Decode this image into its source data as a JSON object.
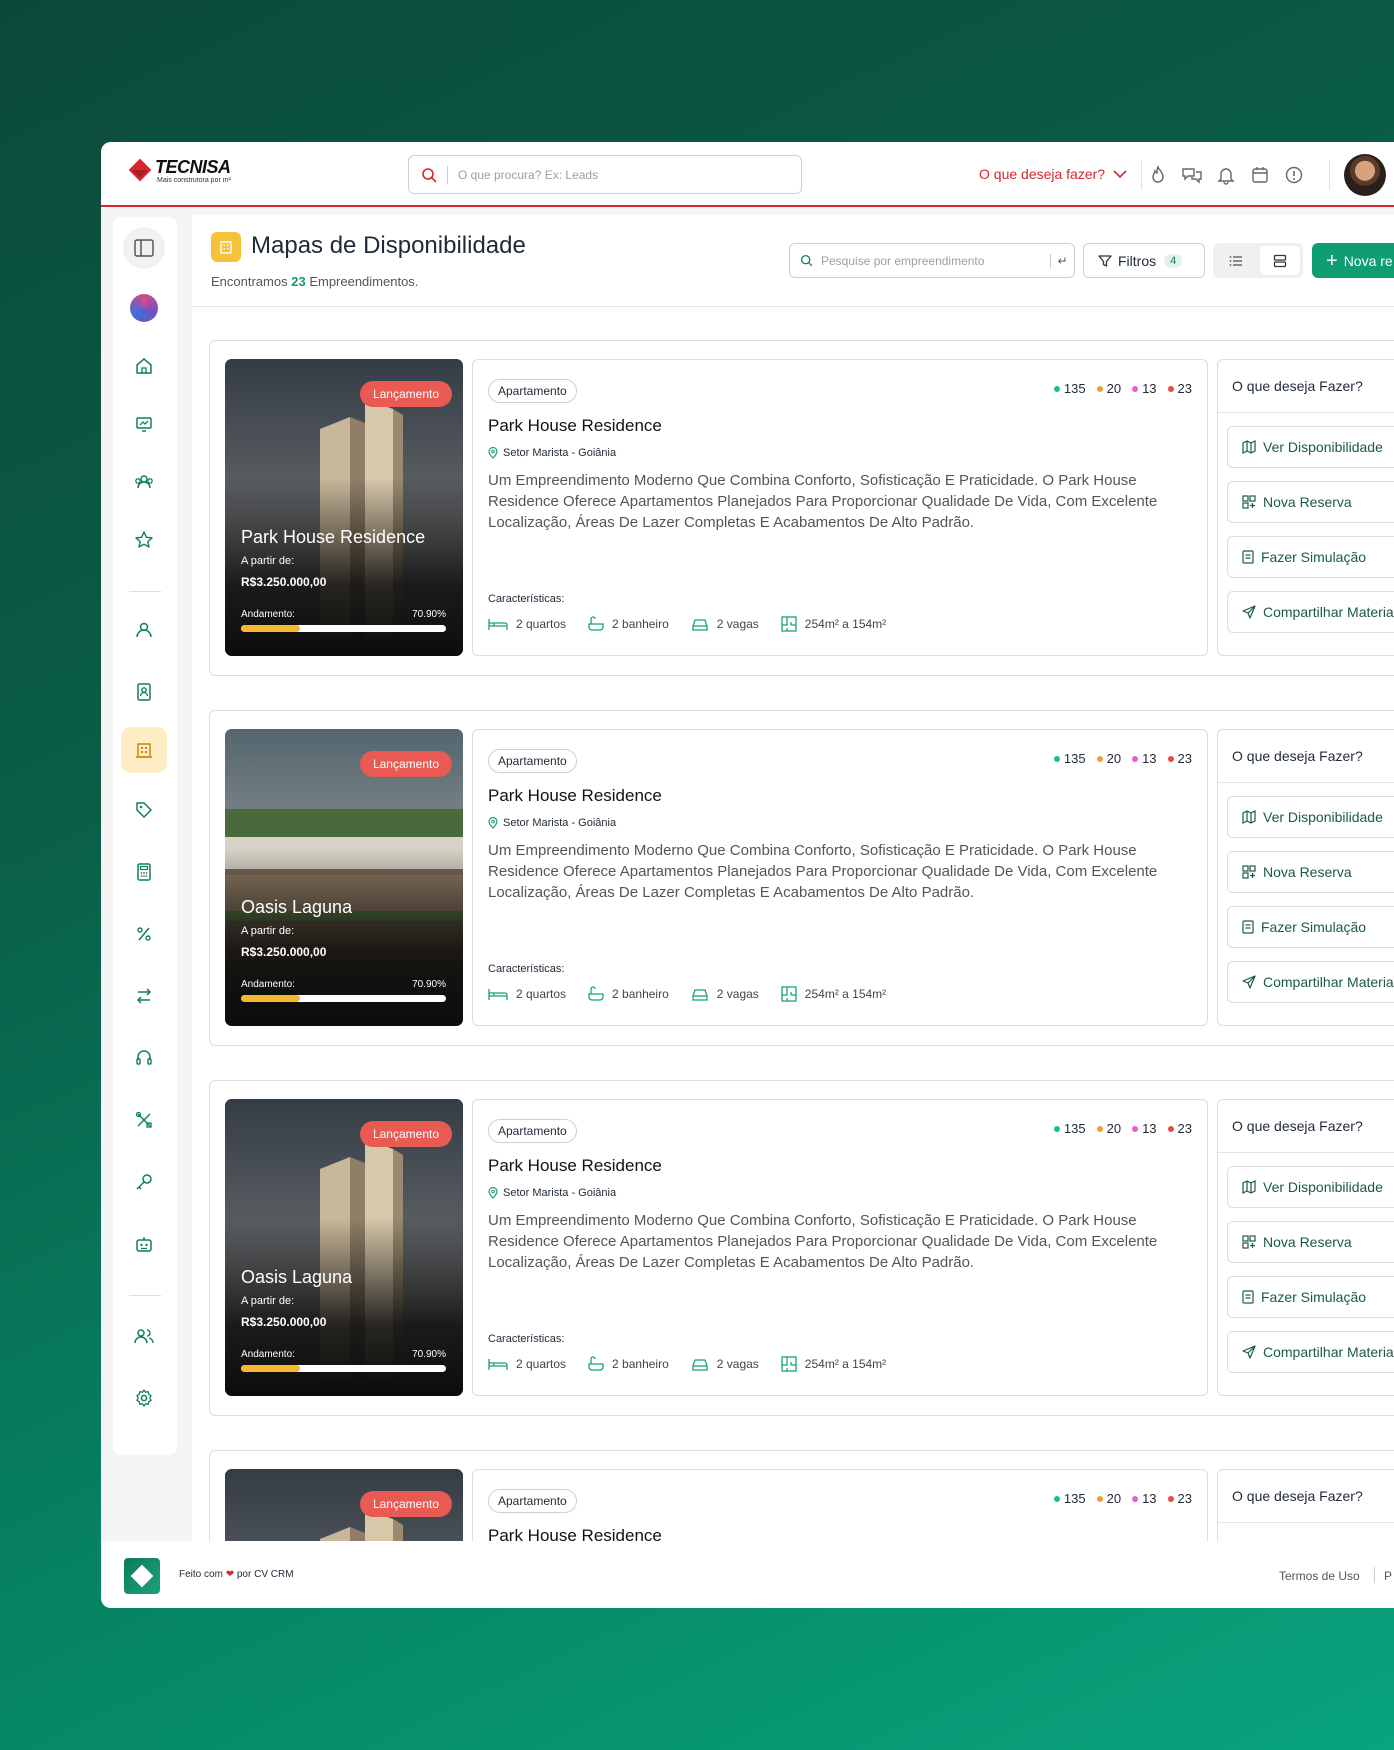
{
  "header": {
    "logo_name": "TECNISA",
    "logo_tagline": "Mais construtora por m²",
    "search_placeholder": "O que procura? Ex: Leads",
    "action_menu": "O que deseja fazer?"
  },
  "page": {
    "title": "Mapas de Disponibilidade",
    "subtitle_prefix": "Encontramos",
    "subtitle_count": "23",
    "subtitle_suffix": "Empreendimentos.",
    "search_placeholder": "Pesquise por empreendimento",
    "filters_label": "Filtros",
    "filters_count": "4",
    "new_button": "Nova re"
  },
  "colors": {
    "brand_red": "#d6262e",
    "accent_green": "#0f9d74",
    "stat_green": "#17c08a",
    "stat_orange": "#f59e2b",
    "stat_pink": "#e85ad6",
    "stat_red": "#e84a4a",
    "progress_yellow": "#f5b731"
  },
  "cards": [
    {
      "badge": "Lançamento",
      "hero_name": "Park House Residence",
      "from_label": "A partir de:",
      "price": "R$3.250.000,00",
      "progress_label": "Andamento:",
      "progress_text": "70.90%",
      "progress": 0.29,
      "type": "Apartamento",
      "stats": [
        "135",
        "20",
        "13",
        "23"
      ],
      "title": "Park House Residence",
      "location": "Setor Marista - Goiânia",
      "description": "Um Empreendimento Moderno Que Combina Conforto, Sofisticação E Praticidade. O Park House Residence Oferece Apartamentos Planejados Para Proporcionar Qualidade De Vida, Com Excelente Localização, Áreas De Lazer Completas E Acabamentos De Alto Padrão.",
      "features_label": "Características:",
      "features": [
        "2 quartos",
        "2 banheiro",
        "2 vagas",
        "254m² a 154m²"
      ],
      "actions_title": "O que deseja Fazer?",
      "actions": [
        "Ver Disponibilidade",
        "Nova Reserva",
        "Fazer Simulação",
        "Compartilhar Material"
      ]
    },
    {
      "badge": "Lançamento",
      "hero_name": "Oasis Laguna",
      "from_label": "A partir de:",
      "price": "R$3.250.000,00",
      "progress_label": "Andamento:",
      "progress_text": "70.90%",
      "progress": 0.29,
      "type": "Apartamento",
      "stats": [
        "135",
        "20",
        "13",
        "23"
      ],
      "title": "Park House Residence",
      "location": "Setor Marista - Goiânia",
      "description": "Um Empreendimento Moderno Que Combina Conforto, Sofisticação E Praticidade. O Park House Residence Oferece Apartamentos Planejados Para Proporcionar Qualidade De Vida, Com Excelente Localização, Áreas De Lazer Completas E Acabamentos De Alto Padrão.",
      "features_label": "Características:",
      "features": [
        "2 quartos",
        "2 banheiro",
        "2 vagas",
        "254m² a 154m²"
      ],
      "actions_title": "O que deseja Fazer?",
      "actions": [
        "Ver Disponibilidade",
        "Nova Reserva",
        "Fazer Simulação",
        "Compartilhar Material"
      ]
    },
    {
      "badge": "Lançamento",
      "hero_name": "Oasis Laguna",
      "from_label": "A partir de:",
      "price": "R$3.250.000,00",
      "progress_label": "Andamento:",
      "progress_text": "70.90%",
      "progress": 0.29,
      "type": "Apartamento",
      "stats": [
        "135",
        "20",
        "13",
        "23"
      ],
      "title": "Park House Residence",
      "location": "Setor Marista - Goiânia",
      "description": "Um Empreendimento Moderno Que Combina Conforto, Sofisticação E Praticidade. O Park House Residence Oferece Apartamentos Planejados Para Proporcionar Qualidade De Vida, Com Excelente Localização, Áreas De Lazer Completas E Acabamentos De Alto Padrão.",
      "features_label": "Características:",
      "features": [
        "2 quartos",
        "2 banheiro",
        "2 vagas",
        "254m² a 154m²"
      ],
      "actions_title": "O que deseja Fazer?",
      "actions": [
        "Ver Disponibilidade",
        "Nova Reserva",
        "Fazer Simulação",
        "Compartilhar Material"
      ]
    },
    {
      "badge": "Lançamento",
      "type": "Apartamento",
      "stats": [
        "135",
        "20",
        "13",
        "23"
      ],
      "title": "Park House Residence",
      "actions_title": "O que deseja Fazer?"
    }
  ],
  "footer": {
    "made_prefix": "Feito com",
    "heart": "❤",
    "made_suffix": "por CV CRM",
    "terms": "Termos de Uso",
    "cut_link": "P"
  }
}
